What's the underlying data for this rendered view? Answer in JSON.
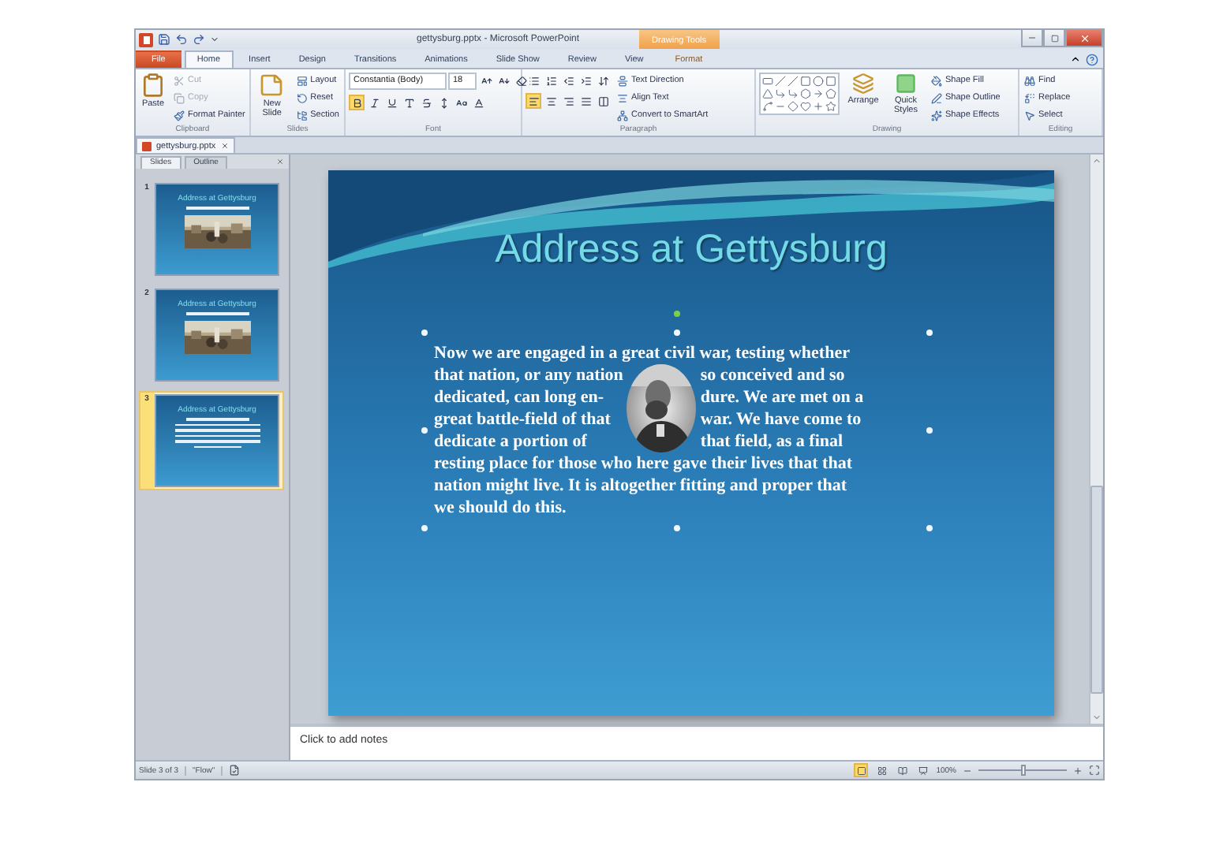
{
  "window": {
    "title": "gettysburg.pptx - Microsoft PowerPoint",
    "context_tab": "Drawing Tools"
  },
  "ribbon_tabs": [
    {
      "label": "File",
      "kind": "file",
      "selected": false
    },
    {
      "label": "Home",
      "kind": "tab",
      "selected": true
    },
    {
      "label": "Insert",
      "kind": "tab",
      "selected": false
    },
    {
      "label": "Design",
      "kind": "tab",
      "selected": false
    },
    {
      "label": "Transitions",
      "kind": "tab",
      "selected": false
    },
    {
      "label": "Animations",
      "kind": "tab",
      "selected": false
    },
    {
      "label": "Slide Show",
      "kind": "tab",
      "selected": false
    },
    {
      "label": "Review",
      "kind": "tab",
      "selected": false
    },
    {
      "label": "View",
      "kind": "tab",
      "selected": false
    },
    {
      "label": "Format",
      "kind": "context",
      "selected": false
    }
  ],
  "ribbon": [
    {
      "kind": "clipboard",
      "label": "Clipboard",
      "large": "Paste",
      "small": [
        {
          "label": "Cut",
          "disabled": true
        },
        {
          "label": "Copy",
          "disabled": true
        },
        {
          "label": "Format Painter",
          "disabled": false
        }
      ]
    },
    {
      "kind": "slides",
      "label": "Slides",
      "large": "New Slide",
      "small": [
        {
          "label": "Layout"
        },
        {
          "label": "Reset"
        },
        {
          "label": "Section"
        }
      ]
    },
    {
      "kind": "font",
      "label": "Font",
      "face": "Constantia (Body)",
      "size": "18",
      "buttons": [
        {
          "kind": "grow",
          "selected": false
        },
        {
          "kind": "shrink",
          "selected": false
        },
        {
          "kind": "clear",
          "selected": false
        },
        {
          "kind": "bold",
          "selected": true
        },
        {
          "kind": "italic",
          "selected": false
        },
        {
          "kind": "underline",
          "selected": false
        },
        {
          "kind": "shadow",
          "selected": false
        },
        {
          "kind": "strike",
          "selected": false
        },
        {
          "kind": "spacing",
          "selected": false
        },
        {
          "kind": "case",
          "selected": false
        },
        {
          "kind": "color",
          "selected": false
        }
      ]
    },
    {
      "kind": "paragraph",
      "label": "Paragraph",
      "buttons": [
        {
          "kind": "bullets",
          "selected": false
        },
        {
          "kind": "numbering",
          "selected": false
        },
        {
          "kind": "outdent",
          "selected": false
        },
        {
          "kind": "indent",
          "selected": false
        },
        {
          "kind": "linespacing",
          "selected": false
        },
        {
          "kind": "left",
          "selected": true
        },
        {
          "kind": "center",
          "selected": false
        },
        {
          "kind": "right",
          "selected": false
        },
        {
          "kind": "justify",
          "selected": false
        },
        {
          "kind": "columns",
          "selected": false
        }
      ],
      "small": [
        {
          "label": "Text Direction"
        },
        {
          "label": "Align Text"
        },
        {
          "label": "Convert to SmartArt"
        }
      ]
    },
    {
      "kind": "drawing",
      "label": "Drawing",
      "large": [
        {
          "label": "Arrange"
        },
        {
          "label": "Quick Styles"
        }
      ],
      "small": [
        {
          "label": "Shape Fill"
        },
        {
          "label": "Shape Outline"
        },
        {
          "label": "Shape Effects"
        }
      ]
    },
    {
      "kind": "editing",
      "label": "Editing",
      "small": [
        {
          "label": "Find"
        },
        {
          "label": "Replace"
        },
        {
          "label": "Select"
        }
      ]
    }
  ],
  "document_tab": "gettysburg.pptx",
  "panel_tabs": [
    {
      "label": "Slides",
      "selected": true
    },
    {
      "label": "Outline",
      "selected": false
    }
  ],
  "thumbnails": [
    {
      "number": "1",
      "title": "Address at Gettysburg",
      "selected": false
    },
    {
      "number": "2",
      "title": "Address at Gettysburg",
      "selected": false
    },
    {
      "number": "3",
      "title": "Address at Gettysburg",
      "kind": "text",
      "selected": true
    }
  ],
  "slide": {
    "title": "Address at Gettysburg",
    "lines_before": [
      "Now we are engaged in a great civil war, testing whether"
    ],
    "split_lines": [
      {
        "left": "that nation, or any nation",
        "right": "so conceived and so"
      },
      {
        "left": "dedicated, can long en-",
        "right": "dure. We are met on a"
      },
      {
        "left": "great battle-field of that",
        "right": "war. We have come to"
      },
      {
        "left": "dedicate a portion of",
        "right": "that field, as a final"
      }
    ],
    "lines_after": [
      "resting place for those who here gave their lives that that",
      "nation might live. It is altogether fitting and proper that",
      "we should do this."
    ]
  },
  "notes": {
    "placeholder": "Click to add notes"
  },
  "status_bar": {
    "slide": "Slide 3 of 3",
    "theme": "\"Flow\"",
    "views": [
      {
        "kind": "normal",
        "selected": true
      },
      {
        "kind": "sorter",
        "selected": false
      },
      {
        "kind": "reading",
        "selected": false
      },
      {
        "kind": "show",
        "selected": false
      }
    ],
    "zoom": "100%",
    "zoom_level": {
      "level": 0.5
    }
  }
}
